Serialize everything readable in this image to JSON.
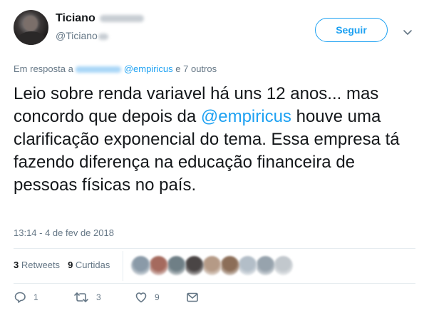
{
  "author": {
    "name": "Ticiano",
    "handle": "@Ticiano"
  },
  "follow_button": {
    "label": "Seguir"
  },
  "reply_context": {
    "prefix": "Em resposta a",
    "mention": "@empiricus",
    "suffix": "e 7 outros"
  },
  "tweet": {
    "part1": "Leio sobre renda variavel há uns 12 anos... mas concordo que depois da ",
    "mention": "@empiricus",
    "part2": " houve uma clarificação exponencial do tema. Essa empresa tá fazendo diferença na educação financeira de pessoas físicas no país."
  },
  "timestamp": "13:14 - 4 de fev de 2018",
  "stats": {
    "retweets_count": "3",
    "retweets_label": "Retweets",
    "likes_count": "9",
    "likes_label": "Curtidas"
  },
  "likers": [
    {
      "color": "#8a9aa8"
    },
    {
      "color": "#a56a5e"
    },
    {
      "color": "#6f7f86"
    },
    {
      "color": "#4a4545"
    },
    {
      "color": "#b59a86"
    },
    {
      "color": "#8c6e58"
    },
    {
      "color": "#b3bec8"
    },
    {
      "color": "#97a3ad"
    },
    {
      "color": "#c2c8cd"
    }
  ],
  "actions": {
    "reply_count": "1",
    "retweet_count": "3",
    "like_count": "9"
  },
  "colors": {
    "accent": "#1da1f2",
    "secondary_text": "#657786",
    "primary_text": "#14171a",
    "divider": "#e6ecf0"
  },
  "icons": [
    "chevron-down-icon",
    "reply-icon",
    "retweet-icon",
    "like-icon",
    "direct-message-icon"
  ]
}
